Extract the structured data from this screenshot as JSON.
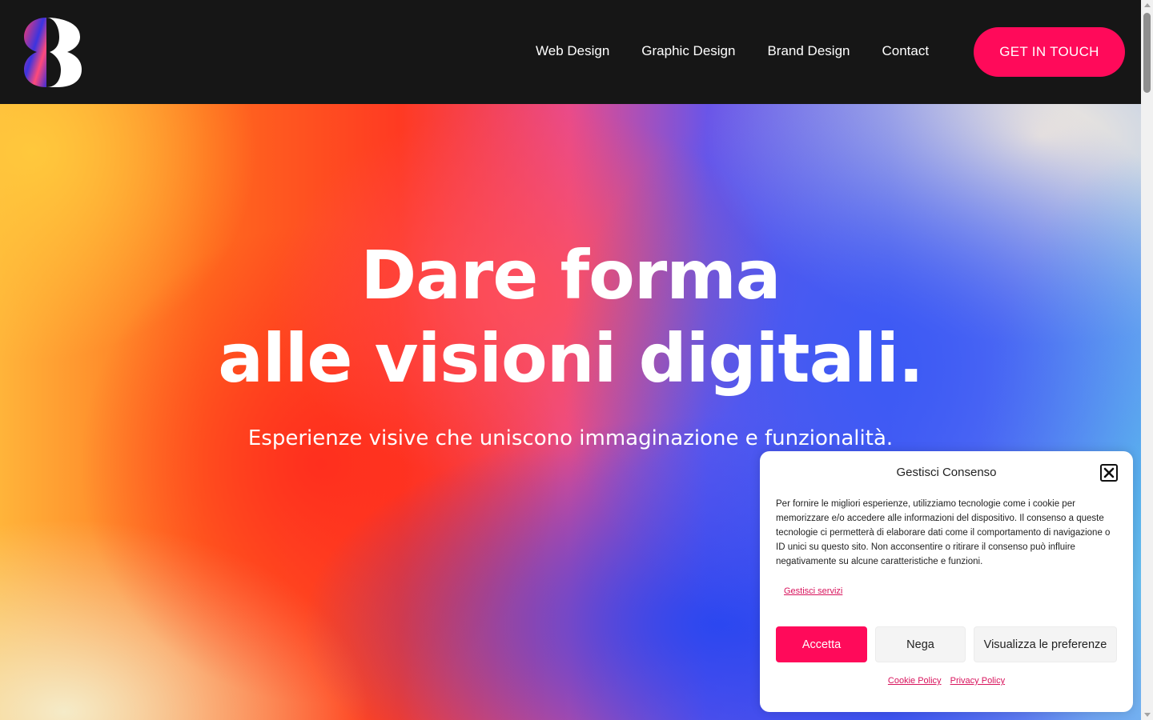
{
  "header": {
    "logo_icon": "brand-logo-icon",
    "nav": [
      {
        "label": "Web Design"
      },
      {
        "label": "Graphic Design"
      },
      {
        "label": "Brand Design"
      },
      {
        "label": "Contact"
      }
    ],
    "cta_label": "GET IN TOUCH"
  },
  "hero": {
    "title_line1": "Dare forma",
    "title_line2": "alle visioni digitali.",
    "subtitle": "Esperienze visive che uniscono immaginazione e funzionalità."
  },
  "cookie": {
    "title": "Gestisci Consenso",
    "close_icon": "close-icon",
    "body": "Per fornire le migliori esperienze, utilizziamo tecnologie come i cookie per memorizzare e/o accedere alle informazioni del dispositivo. Il consenso a queste tecnologie ci permetterà di elaborare dati come il comportamento di navigazione o ID unici su questo sito. Non acconsentire o ritirare il consenso può influire negativamente su alcune caratteristiche e funzioni.",
    "manage_link": "Gestisci servizi",
    "accept": "Accetta",
    "deny": "Nega",
    "preferences": "Visualizza le preferenze",
    "cookie_policy": "Cookie Policy",
    "privacy_policy": "Privacy Policy"
  },
  "colors": {
    "header_bg": "#161616",
    "accent": "#ff0a5a",
    "link": "#d8135c"
  }
}
